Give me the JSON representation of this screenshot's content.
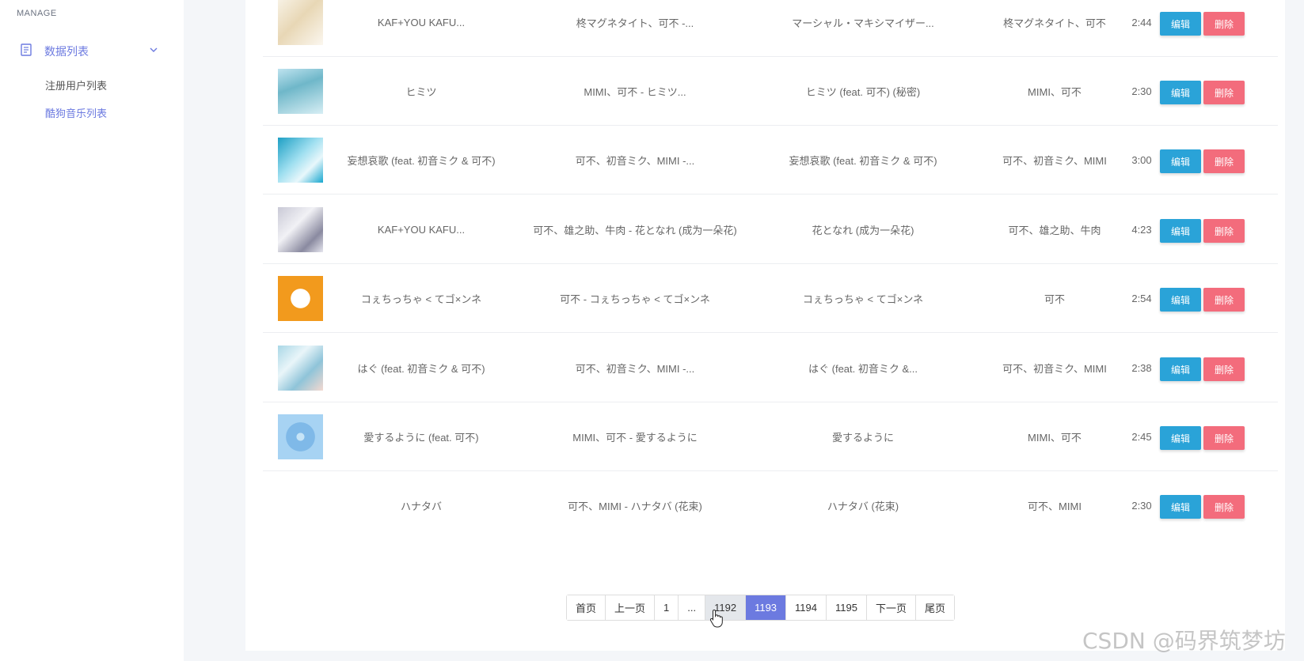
{
  "sidebar": {
    "section_label": "MANAGE",
    "group_label": "数据列表",
    "items": [
      {
        "label": "注册用户列表"
      },
      {
        "label": "酷狗音乐列表"
      }
    ]
  },
  "songs": [
    {
      "name": "KAF+YOU KAFU...",
      "full_title": "柊マグネタイト、可不 -...",
      "album": "マーシャル・マキシマイザー...",
      "artists": "柊マグネタイト、可不",
      "duration": "2:44"
    },
    {
      "name": "ヒミツ",
      "full_title": "MIMI、可不 - ヒミツ...",
      "album": "ヒミツ (feat. 可不) (秘密)",
      "artists": "MIMI、可不",
      "duration": "2:30"
    },
    {
      "name": "妄想哀歌 (feat. 初音ミク & 可不)",
      "full_title": "可不、初音ミク、MIMI -...",
      "album": "妄想哀歌 (feat. 初音ミク & 可不)",
      "artists": "可不、初音ミク、MIMI",
      "duration": "3:00"
    },
    {
      "name": "KAF+YOU KAFU...",
      "full_title": "可不、雄之助、牛肉 - 花となれ (成为一朵花)",
      "album": "花となれ (成为一朵花)",
      "artists": "可不、雄之助、牛肉",
      "duration": "4:23"
    },
    {
      "name": "コぇちっちゃ < てゴ×ンネ",
      "full_title": "可不 - コぇちっちゃ < てゴ×ンネ",
      "album": "コぇちっちゃ < てゴ×ンネ",
      "artists": "可不",
      "duration": "2:54"
    },
    {
      "name": "はぐ (feat. 初音ミク & 可不)",
      "full_title": "可不、初音ミク、MIMI -...",
      "album": "はぐ (feat. 初音ミク &...",
      "artists": "可不、初音ミク、MIMI",
      "duration": "2:38"
    },
    {
      "name": "愛するように (feat. 可不)",
      "full_title": "MIMI、可不 - 愛するように",
      "album": "愛するように",
      "artists": "MIMI、可不",
      "duration": "2:45"
    },
    {
      "name": "ハナタバ",
      "full_title": "可不、MIMI - ハナタバ (花束)",
      "album": "ハナタバ (花束)",
      "artists": "可不、MIMI",
      "duration": "2:30"
    }
  ],
  "actions": {
    "edit_label": "编辑",
    "delete_label": "删除"
  },
  "pagination": {
    "items": [
      "首页",
      "上一页",
      "1",
      "...",
      "1192",
      "1193",
      "1194",
      "1195",
      "下一页",
      "尾页"
    ],
    "current": "1193",
    "hovered": "1192"
  },
  "watermark": "CSDN @码界筑梦坊",
  "colors": {
    "accent": "#6c7ae0",
    "edit": "#2aa3d8",
    "delete": "#f36c7c"
  }
}
